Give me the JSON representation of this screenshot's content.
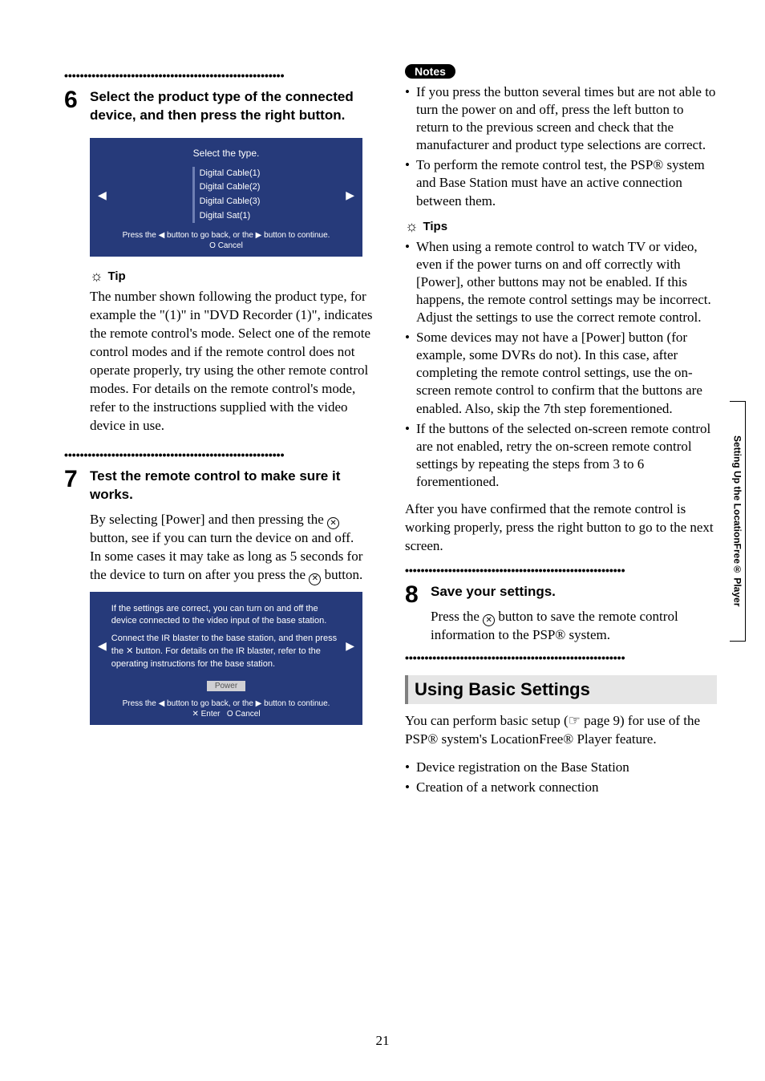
{
  "left": {
    "dots": "••••••••••••••••••••••••••••••••••••••••••••••••••••••••",
    "step6": {
      "num": "6",
      "title": "Select the product type of the connected device, and then press the right button."
    },
    "screen1": {
      "title": "Select the type.",
      "items": [
        "Digital Cable(1)",
        "Digital Cable(2)",
        "Digital Cable(3)",
        "Digital Sat(1)"
      ],
      "nav_left": "◀",
      "nav_right": "▶",
      "nav": "Press the ◀ button to go back, or the ▶ button to continue.",
      "sub": "Cancel",
      "sub_icon": "O"
    },
    "tip_label": "Tip",
    "tip_text": "The number shown following the product type, for example the \"(1)\" in \"DVD Recorder (1)\", indicates the remote control's mode. Select one of the remote control modes and if the remote control does not operate properly, try using the other remote control modes. For details on the remote control's mode, refer to the instructions supplied with the video device in use.",
    "step7": {
      "num": "7",
      "title": "Test the remote control to make sure it works.",
      "p1a": "By selecting [Power] and then pressing the ",
      "p1b": " button, see if you can turn the device on and off.",
      "p2a": "In some cases it may take as long as 5 seconds for the device to turn on after you press the ",
      "p2b": " button."
    },
    "screen2": {
      "body1": "If the settings are correct, you can turn on and off the device connected to the video input of the base station.",
      "body2": "Connect the IR blaster to the base station, and then press the ✕ button. For details on the IR blaster, refer to the operating instructions for the base station.",
      "power": "Power",
      "nav_left": "◀",
      "nav_right": "▶",
      "nav": "Press the ◀ button to go back, or the ▶ button to continue.",
      "sub_x": "✕",
      "sub_enter": "Enter",
      "sub_o": "O",
      "sub_cancel": "Cancel"
    }
  },
  "right": {
    "notes_label": "Notes",
    "notes": [
      "If you press the button several times but are not able to turn the power on and off, press the left button to return to the previous screen and check that the manufacturer and product type selections are correct.",
      "To perform the remote control test, the PSP® system and Base Station must have an active connection between them."
    ],
    "tips_label": "Tips",
    "tips": [
      "When using a remote control to watch TV or video, even if the power turns on and off correctly with [Power], other buttons may not be enabled. If this happens, the remote control settings may be incorrect. Adjust the settings to use the correct remote control.",
      "Some devices may not have a [Power] button (for example, some DVRs do not). In this case, after completing the remote control settings, use the on-screen remote control to confirm that the buttons are enabled. Also, skip the 7th step forementioned.",
      "If the buttons of the selected on-screen remote control are not enabled, retry the on-screen remote control settings by repeating the steps from 3 to 6 forementioned."
    ],
    "after": "After you have confirmed that the remote control is working properly, press the right button to go to the next screen.",
    "dots": "••••••••••••••••••••••••••••••••••••••••••••••••••••••••",
    "step8": {
      "num": "8",
      "title": "Save your settings.",
      "p_a": "Press the ",
      "p_b": " button to save the remote control information to the PSP® system."
    },
    "section": "Using Basic Settings",
    "section_text_a": "You can perform basic setup (",
    "section_text_b": " page 9) for use of the PSP® system's LocationFree® Player feature.",
    "section_list": [
      "Device registration on the Base Station",
      "Creation of a network connection"
    ]
  },
  "side_tab": "Setting Up the LocationFree® Player",
  "page_number": "21",
  "icons": {
    "tip": "☼",
    "hand": "☞",
    "x": "✕"
  }
}
